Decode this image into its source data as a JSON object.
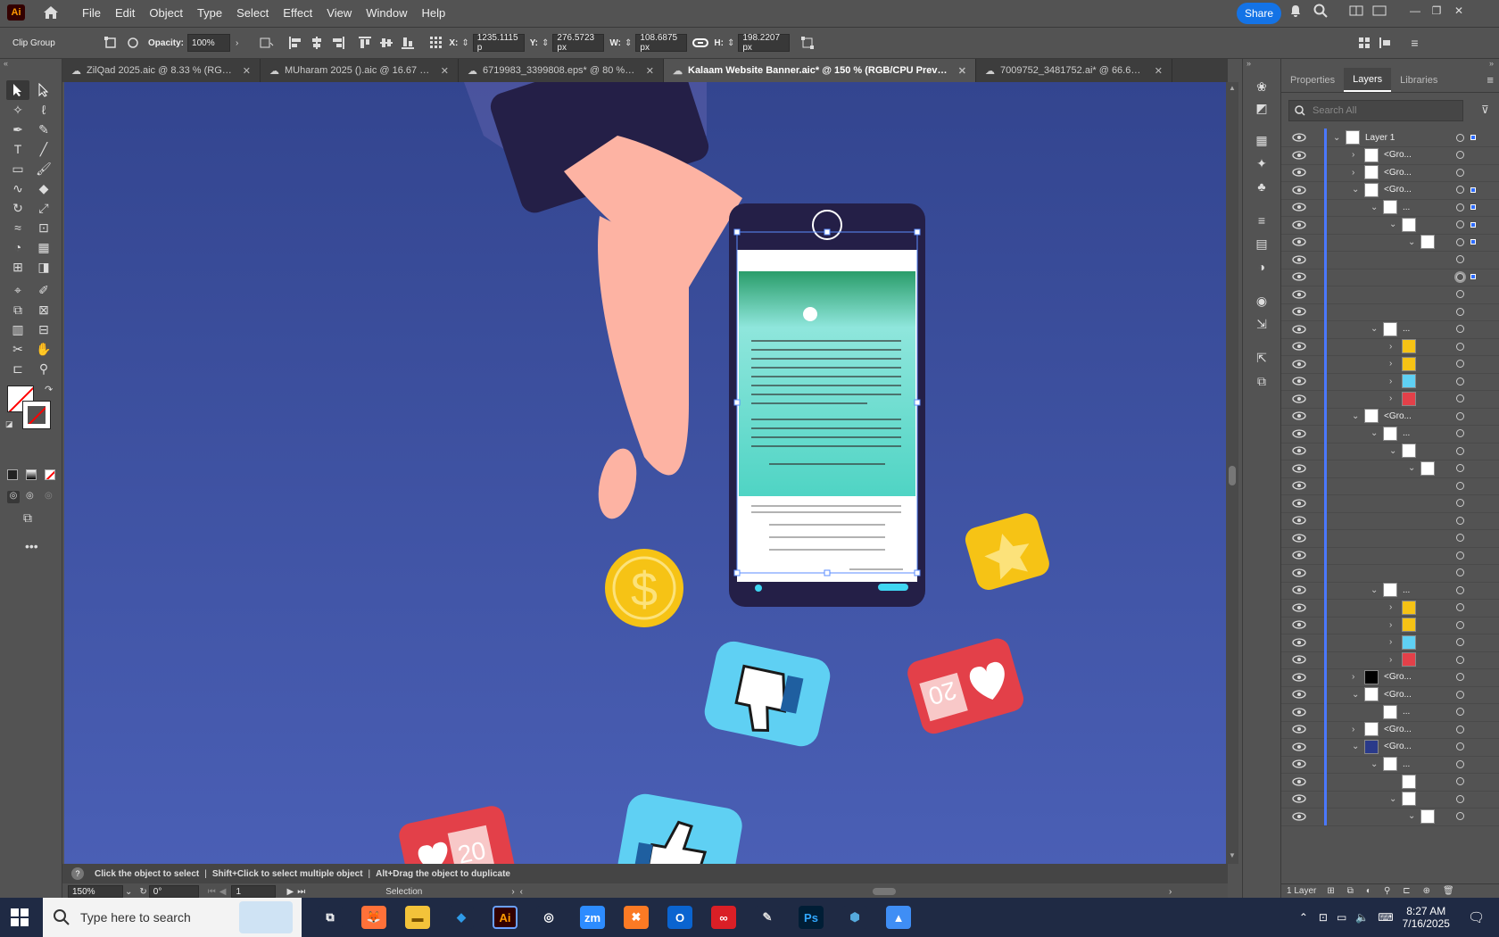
{
  "app": {
    "logo": "Ai"
  },
  "menu": [
    "File",
    "Edit",
    "Object",
    "Type",
    "Select",
    "Effect",
    "View",
    "Window",
    "Help"
  ],
  "share_label": "Share",
  "control": {
    "selection_type": "Clip Group",
    "opacity_label": "Opacity:",
    "opacity_value": "100%",
    "x_label": "X:",
    "x_value": "1235.1115 p",
    "y_label": "Y:",
    "y_value": "276.5723 px",
    "w_label": "W:",
    "w_value": "108.6875 px",
    "h_label": "H:",
    "h_value": "198.2207 px"
  },
  "tabs": [
    {
      "label": "ZilQad 2025.aic @ 8.33 % (RGB/...",
      "active": false
    },
    {
      "label": "MUharam 2025 ().aic @ 16.67 %...",
      "active": false
    },
    {
      "label": "6719983_3399808.eps* @ 80 % (RGB/...",
      "active": false
    },
    {
      "label": "Kalaam Website Banner.aic* @ 150 % (RGB/CPU Preview)",
      "active": true
    },
    {
      "label": "7009752_3481752.ai* @ 66.67 % (RG...",
      "active": false
    }
  ],
  "canvas": {
    "bg_color": "#3a4d9e",
    "badge_count_1": "20",
    "badge_count_2": "20",
    "coin_symbol": "$"
  },
  "status": {
    "hint": "Click the object to select",
    "hint2": "Shift+Click to select multiple object",
    "hint3": "Alt+Drag the object to duplicate"
  },
  "bottom": {
    "zoom": "150%",
    "rotation": "0°",
    "artboard": "1",
    "mode": "Selection"
  },
  "panel": {
    "tabs": [
      "Properties",
      "Layers",
      "Libraries"
    ],
    "active_tab": "Layers",
    "search_placeholder": "Search All",
    "footer": "1 Layer",
    "layers": [
      {
        "indent": 0,
        "expanded": true,
        "name": "Layer 1",
        "thumb": "layer",
        "sq": true
      },
      {
        "indent": 1,
        "expanded": false,
        "name": "<Gro...",
        "thumb": "phone",
        "sq": false
      },
      {
        "indent": 1,
        "expanded": false,
        "name": "<Gro...",
        "thumb": "phone",
        "sq": false
      },
      {
        "indent": 1,
        "expanded": true,
        "name": "<Gro...",
        "thumb": "phone",
        "sq": true
      },
      {
        "indent": 2,
        "expanded": true,
        "name": "...",
        "thumb": "phone",
        "sq": true
      },
      {
        "indent": 3,
        "expanded": true,
        "name": "",
        "thumb": "phone",
        "sq": true
      },
      {
        "indent": 4,
        "expanded": true,
        "name": "",
        "thumb": "phone",
        "sq": true
      },
      {
        "indent": 5,
        "expanded": null,
        "name": "",
        "thumb": "none",
        "sq": false
      },
      {
        "indent": 5,
        "expanded": null,
        "name": "",
        "thumb": "none",
        "sq": true,
        "target": true
      },
      {
        "indent": 5,
        "expanded": null,
        "name": "",
        "thumb": "none",
        "sq": false
      },
      {
        "indent": 5,
        "expanded": null,
        "name": "",
        "thumb": "none",
        "sq": false
      },
      {
        "indent": 2,
        "expanded": true,
        "name": "...",
        "thumb": "white",
        "sq": false
      },
      {
        "indent": 3,
        "expanded": false,
        "name": "",
        "thumb": "yellow",
        "sq": false
      },
      {
        "indent": 3,
        "expanded": false,
        "name": "",
        "thumb": "yellow",
        "sq": false
      },
      {
        "indent": 3,
        "expanded": false,
        "name": "",
        "thumb": "cyan",
        "sq": false
      },
      {
        "indent": 3,
        "expanded": false,
        "name": "",
        "thumb": "red",
        "sq": false
      },
      {
        "indent": 1,
        "expanded": true,
        "name": "<Gro...",
        "thumb": "phone",
        "sq": false
      },
      {
        "indent": 2,
        "expanded": true,
        "name": "...",
        "thumb": "phone",
        "sq": false
      },
      {
        "indent": 3,
        "expanded": true,
        "name": "",
        "thumb": "phone",
        "sq": false
      },
      {
        "indent": 4,
        "expanded": true,
        "name": "",
        "thumb": "phone",
        "sq": false
      },
      {
        "indent": 5,
        "expanded": null,
        "name": "",
        "thumb": "none",
        "sq": false
      },
      {
        "indent": 5,
        "expanded": null,
        "name": "",
        "thumb": "none",
        "sq": false
      },
      {
        "indent": 5,
        "expanded": null,
        "name": "",
        "thumb": "none",
        "sq": false
      },
      {
        "indent": 5,
        "expanded": null,
        "name": "",
        "thumb": "none",
        "sq": false
      },
      {
        "indent": 5,
        "expanded": null,
        "name": "",
        "thumb": "none",
        "sq": false
      },
      {
        "indent": 5,
        "expanded": null,
        "name": "",
        "thumb": "none",
        "sq": false
      },
      {
        "indent": 2,
        "expanded": true,
        "name": "...",
        "thumb": "white",
        "sq": false
      },
      {
        "indent": 3,
        "expanded": false,
        "name": "",
        "thumb": "yellow",
        "sq": false
      },
      {
        "indent": 3,
        "expanded": false,
        "name": "",
        "thumb": "yellow",
        "sq": false
      },
      {
        "indent": 3,
        "expanded": false,
        "name": "",
        "thumb": "cyan",
        "sq": false
      },
      {
        "indent": 3,
        "expanded": false,
        "name": "",
        "thumb": "red",
        "sq": false
      },
      {
        "indent": 1,
        "expanded": false,
        "name": "<Gro...",
        "thumb": "black",
        "sq": false
      },
      {
        "indent": 1,
        "expanded": true,
        "name": "<Gro...",
        "thumb": "white",
        "sq": false
      },
      {
        "indent": 2,
        "expanded": null,
        "name": "...",
        "thumb": "white",
        "sq": false
      },
      {
        "indent": 1,
        "expanded": false,
        "name": "<Gro...",
        "thumb": "white",
        "sq": false
      },
      {
        "indent": 1,
        "expanded": true,
        "name": "<Gro...",
        "thumb": "navy",
        "sq": false
      },
      {
        "indent": 2,
        "expanded": true,
        "name": "...",
        "thumb": "white",
        "sq": false
      },
      {
        "indent": 3,
        "expanded": null,
        "name": "",
        "thumb": "lines",
        "sq": false
      },
      {
        "indent": 3,
        "expanded": true,
        "name": "",
        "thumb": "phone",
        "sq": false
      },
      {
        "indent": 4,
        "expanded": true,
        "name": "",
        "thumb": "phone",
        "sq": false
      }
    ]
  },
  "taskbar": {
    "search_placeholder": "Type here to search",
    "apps": [
      "task-view",
      "firefox",
      "file-explorer",
      "vscode",
      "illustrator",
      "chrome",
      "zoom",
      "xampp",
      "outlook",
      "creative-cloud",
      "pen-tool",
      "photoshop",
      "app-blue",
      "app-image"
    ],
    "time": "8:27 AM",
    "date": "7/16/2025"
  }
}
